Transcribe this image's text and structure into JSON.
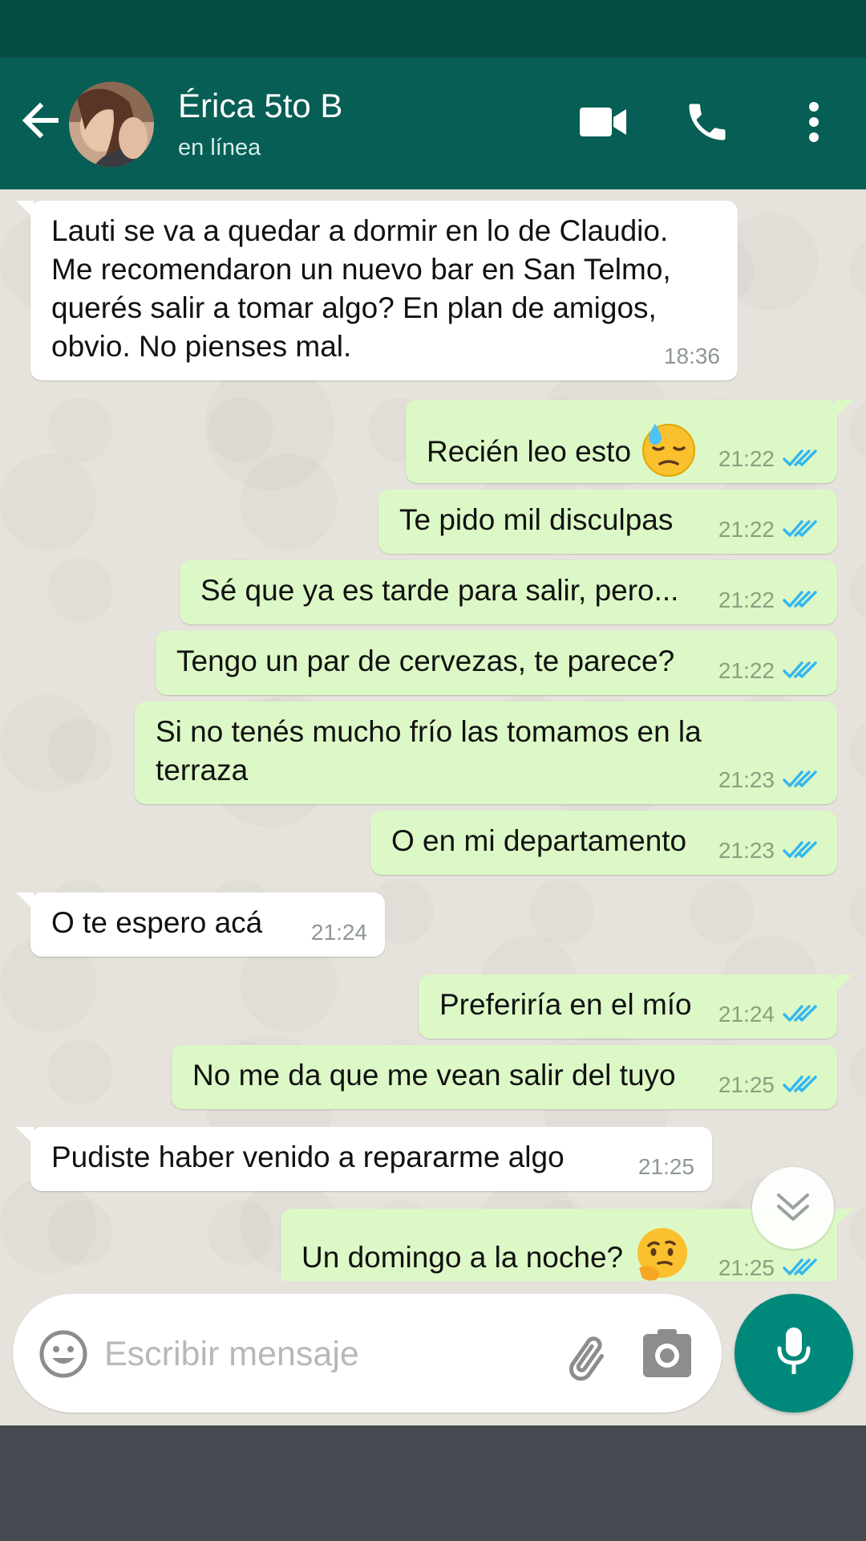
{
  "header": {
    "contact_name": "Érica 5to B",
    "contact_status": "en línea",
    "icons": [
      "back-arrow-icon",
      "video-call-icon",
      "phone-icon",
      "more-vert-icon"
    ],
    "accent_color": "#075e54"
  },
  "messages": [
    {
      "direction": "in",
      "text_lines": [
        "Lauti se va a quedar a dormir en lo de Claudio.",
        "Me recomendaron un nuevo bar en San Telmo,",
        "querés salir a tomar algo? En plan de amigos,",
        "obvio. No pienses mal."
      ],
      "time": "18:36"
    },
    {
      "direction": "out",
      "text": "Recién leo esto",
      "emoji": "downcast-face-with-sweat-emoji",
      "time": "21:22",
      "status": "read"
    },
    {
      "direction": "out",
      "text": "Te pido mil disculpas",
      "time": "21:22",
      "status": "read"
    },
    {
      "direction": "out",
      "text": "Sé que ya es tarde para salir, pero...",
      "time": "21:22",
      "status": "read"
    },
    {
      "direction": "out",
      "text": "Tengo un par de cervezas, te parece?",
      "time": "21:22",
      "status": "read"
    },
    {
      "direction": "out",
      "text_lines": [
        "Si no tenés mucho frío las tomamos en la",
        "terraza"
      ],
      "time": "21:23",
      "status": "read"
    },
    {
      "direction": "out",
      "text": "O en mi departamento",
      "time": "21:23",
      "status": "read"
    },
    {
      "direction": "in",
      "text": "O te espero acá",
      "time": "21:24"
    },
    {
      "direction": "out",
      "text": "Preferiría en el mío",
      "time": "21:24",
      "status": "read"
    },
    {
      "direction": "out",
      "text": "No me da que me vean salir del tuyo",
      "time": "21:25",
      "status": "read"
    },
    {
      "direction": "in",
      "text": "Pudiste haber venido a repararme algo",
      "time": "21:25"
    },
    {
      "direction": "out",
      "text": "Un domingo a la noche?",
      "emoji": "thinking-face-emoji",
      "time": "21:25",
      "status": "read"
    }
  ],
  "composer": {
    "placeholder": "Escribir mensaje",
    "icons": [
      "emoji-icon",
      "attach-icon",
      "camera-icon",
      "mic-icon"
    ]
  },
  "colors": {
    "incoming_bubble": "#ffffff",
    "outgoing_bubble": "#dcf8c6",
    "read_ticks": "#34b7f1",
    "mic_button": "#00897b"
  }
}
